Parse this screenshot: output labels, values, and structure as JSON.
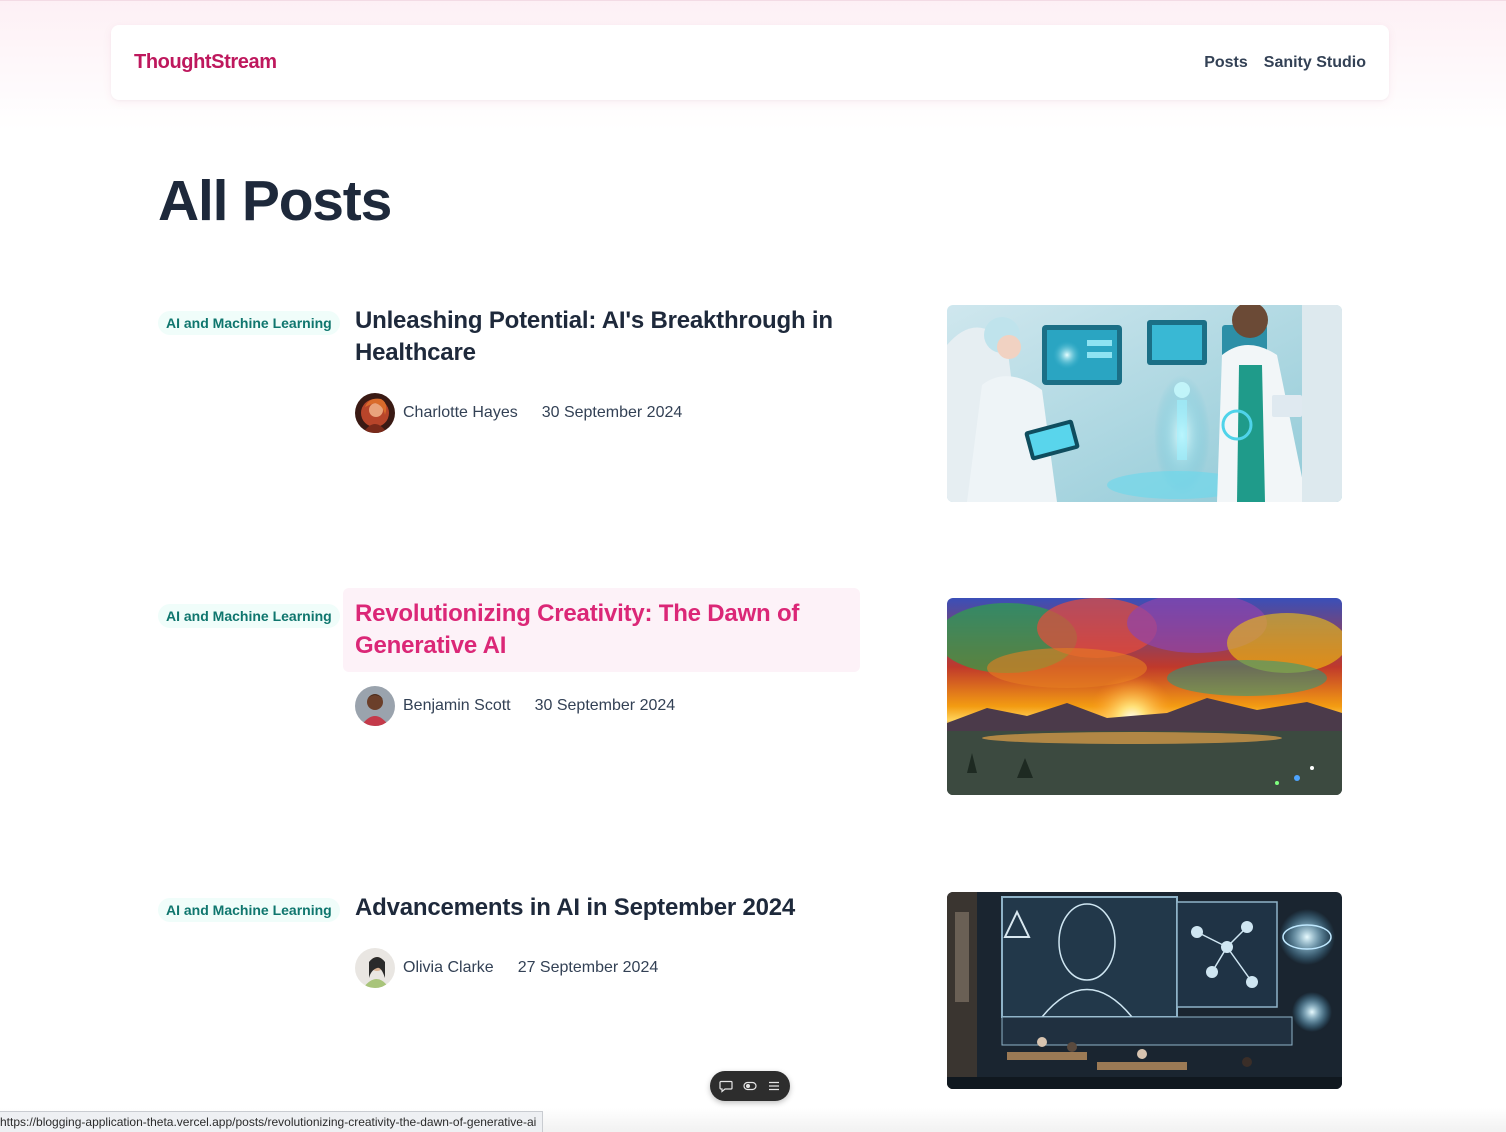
{
  "header": {
    "brand": "ThoughtStream",
    "nav": [
      {
        "label": "Posts"
      },
      {
        "label": "Sanity Studio"
      }
    ]
  },
  "main": {
    "title": "All Posts",
    "posts": [
      {
        "category": "AI and Machine Learning",
        "title": "Unleashing Potential: AI's Breakthrough in Healthcare",
        "author": "Charlotte Hayes",
        "date": "30 September 2024"
      },
      {
        "category": "AI and Machine Learning",
        "title": "Revolutionizing Creativity: The Dawn of Generative AI",
        "author": "Benjamin Scott",
        "date": "30 September 2024",
        "hovered": true
      },
      {
        "category": "AI and Machine Learning",
        "title": "Advancements in AI in September 2024",
        "author": "Olivia Clarke",
        "date": "27 September 2024"
      }
    ]
  },
  "floating_toolbar": {
    "icons": [
      "comment-icon",
      "toggle-icon",
      "menu-icon"
    ]
  },
  "status_bar": {
    "url": "https://blogging-application-theta.vercel.app/posts/revolutionizing-creativity-the-dawn-of-generative-ai"
  },
  "colors": {
    "brand": "#be185d",
    "tag_text": "#0f766e",
    "tag_bg": "#f0fdfa",
    "hover_title": "#db2777",
    "hover_bg": "#fdf2f8",
    "heading": "#1e293b"
  }
}
